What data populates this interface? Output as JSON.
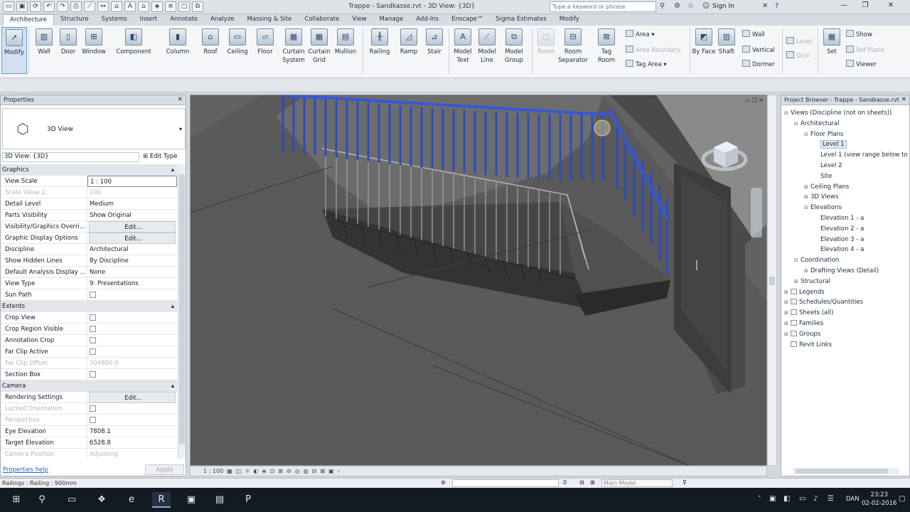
{
  "titlebar": {
    "doc_title": "Trappe - Sandkasse.rvt - 3D View: {3D}",
    "search_placeholder": "Type a keyword or phrase",
    "signin": "Sign In"
  },
  "tabs": [
    "Architecture",
    "Structure",
    "Systems",
    "Insert",
    "Annotate",
    "Analyze",
    "Massing & Site",
    "Collaborate",
    "View",
    "Manage",
    "Add-Ins",
    "Enscape™",
    "Sigma Estimates",
    "Modify"
  ],
  "ribbon": {
    "modify": "Modify",
    "wall": "Wall",
    "door": "Door",
    "window": "Window",
    "component": "Component",
    "column": "Column",
    "roof": "Roof",
    "ceiling": "Ceiling",
    "floor": "Floor",
    "curtain_system": "Curtain System",
    "curtain_grid": "Curtain Grid",
    "mullion": "Mullion",
    "railing": "Railing",
    "ramp": "Ramp",
    "stair": "Stair",
    "model_text": "Model Text",
    "model_line": "Model Line",
    "model_group": "Model Group",
    "room": "Room",
    "room_separator": "Room Separator",
    "tag_room": "Tag Room",
    "area": "Area",
    "area_boundary": "Area Boundary",
    "tag_area": "Tag Area",
    "by_face": "By Face",
    "shaft": "Shaft",
    "wall_small": "Wall",
    "vertical": "Vertical",
    "dormer": "Dormer",
    "level": "Level",
    "grid": "Grid",
    "set": "Set",
    "show": "Show",
    "ref_plane": "Ref Plane",
    "viewer": "Viewer"
  },
  "properties": {
    "title": "Properties",
    "type_name": "3D View",
    "instance_selector": "3D View: {3D}",
    "edit_type": "Edit Type",
    "rows": [
      {
        "group": "Graphics"
      },
      {
        "k": "View Scale",
        "v": "1 : 100",
        "style": "inp"
      },
      {
        "k": "Scale Value    1:",
        "v": "100",
        "dis": true
      },
      {
        "k": "Detail Level",
        "v": "Medium"
      },
      {
        "k": "Parts Visibility",
        "v": "Show Original"
      },
      {
        "k": "Visibility/Graphics Overri...",
        "v": "Edit...",
        "style": "btn"
      },
      {
        "k": "Graphic Display Options",
        "v": "Edit...",
        "style": "btn"
      },
      {
        "k": "Discipline",
        "v": "Architectural"
      },
      {
        "k": "Show Hidden Lines",
        "v": "By Discipline"
      },
      {
        "k": "Default Analysis Display ...",
        "v": "None"
      },
      {
        "k": "View Type",
        "v": "9: Presentations"
      },
      {
        "k": "Sun Path",
        "chk": true
      },
      {
        "group": "Extents"
      },
      {
        "k": "Crop View",
        "chk": true
      },
      {
        "k": "Crop Region Visible",
        "chk": true
      },
      {
        "k": "Annotation Crop",
        "chk": true
      },
      {
        "k": "Far Clip Active",
        "chk": true
      },
      {
        "k": "Far Clip Offset",
        "v": "304800.0",
        "dis": true
      },
      {
        "k": "Section Box",
        "chk": true
      },
      {
        "group": "Camera"
      },
      {
        "k": "Rendering Settings",
        "v": "Edit...",
        "style": "btn"
      },
      {
        "k": "Locked Orientation",
        "chk": true,
        "dis": true
      },
      {
        "k": "Perspective",
        "chk": true,
        "dis": true
      },
      {
        "k": "Eye Elevation",
        "v": "7808.1"
      },
      {
        "k": "Target Elevation",
        "v": "6528.8"
      },
      {
        "k": "Camera Position",
        "v": "Adjusting",
        "dis": true
      }
    ],
    "help": "Properties help",
    "apply": "Apply"
  },
  "view_control": {
    "scale": "1 : 100"
  },
  "browser": {
    "title": "Project Browser - Trappe - Sandkasse.rvt",
    "nodes": [
      {
        "d": 0,
        "t": "Views (Discipline (not on sheets))",
        "tw": "⊟"
      },
      {
        "d": 1,
        "t": "Architectural",
        "tw": "⊟"
      },
      {
        "d": 2,
        "t": "Floor Plans",
        "tw": "⊟"
      },
      {
        "d": 3,
        "t": "Level 1",
        "sel": true
      },
      {
        "d": 3,
        "t": "Level 1 (view range below to"
      },
      {
        "d": 3,
        "t": "Level 2"
      },
      {
        "d": 3,
        "t": "Site"
      },
      {
        "d": 2,
        "t": "Ceiling Plans",
        "tw": "⊞"
      },
      {
        "d": 2,
        "t": "3D Views",
        "tw": "⊞"
      },
      {
        "d": 2,
        "t": "Elevations",
        "tw": "⊟"
      },
      {
        "d": 3,
        "t": "Elevation 1 - a"
      },
      {
        "d": 3,
        "t": "Elevation 2 - a"
      },
      {
        "d": 3,
        "t": "Elevation 3 - a"
      },
      {
        "d": 3,
        "t": "Elevation 4 - a"
      },
      {
        "d": 1,
        "t": "Coordination",
        "tw": "⊟"
      },
      {
        "d": 2,
        "t": "Drafting Views (Detail)",
        "tw": "⊞"
      },
      {
        "d": 1,
        "t": "Structural",
        "tw": "⊞"
      },
      {
        "d": 0,
        "t": "Legends",
        "tw": "⊞",
        "ico": true
      },
      {
        "d": 0,
        "t": "Schedules/Quantities",
        "tw": "⊞",
        "ico": true
      },
      {
        "d": 0,
        "t": "Sheets (all)",
        "tw": "⊞",
        "ico": true
      },
      {
        "d": 0,
        "t": "Families",
        "tw": "⊞",
        "ico": true
      },
      {
        "d": 0,
        "t": "Groups",
        "tw": "⊞",
        "ico": true
      },
      {
        "d": 0,
        "t": "Revit Links",
        "tw": "",
        "ico": true
      }
    ]
  },
  "status": {
    "text": "Railings : Railing : 900mm",
    "zero": "0",
    "model": "Main Model"
  },
  "taskbar": {
    "lang": "DAN",
    "time": "23:23",
    "date": "02-02-2016"
  }
}
